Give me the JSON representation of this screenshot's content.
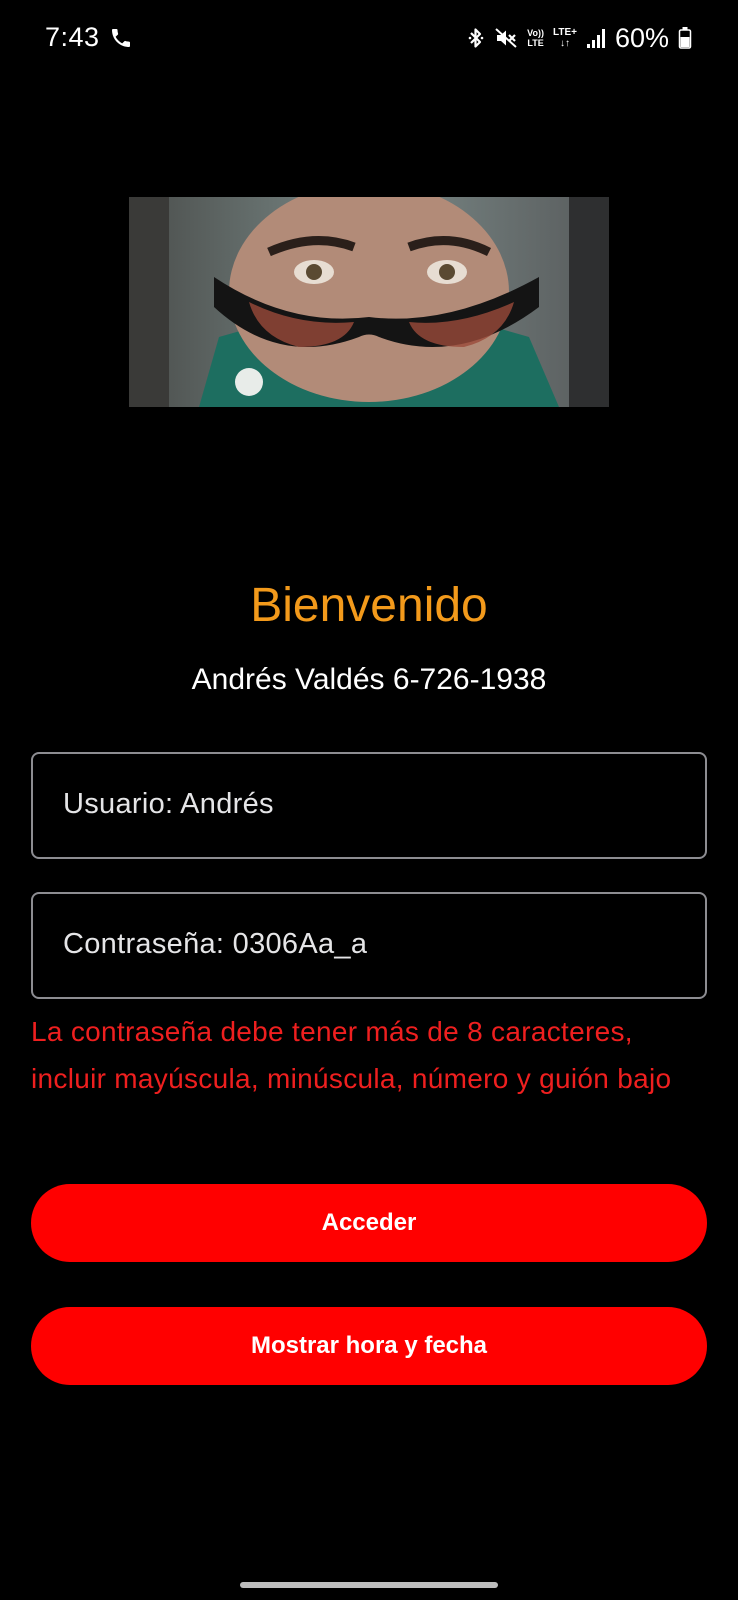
{
  "status_bar": {
    "time": "7:43",
    "icons": [
      "call-icon",
      "bluetooth-icon",
      "mute-icon",
      "volte-icon",
      "lte-plus-icon",
      "signal-icon",
      "battery-icon"
    ],
    "volte_top": "Vo))",
    "volte_bottom": "LTE",
    "lte_top": "LTE+",
    "lte_bottom": "↓↑",
    "battery": "60%"
  },
  "profile_image": {
    "description": "profile-photo"
  },
  "welcome": {
    "title": "Bienvenido",
    "user_info": "Andrés Valdés 6-726-1938"
  },
  "form": {
    "username_text": "Usuario: Andrés",
    "password_text": "Contraseña: 0306Aa_a",
    "error_message": "La contraseña debe tener más de 8 caracteres, incluir mayúscula, minúscula, número y guión bajo"
  },
  "buttons": {
    "access_label": "Acceder",
    "show_time_label": "Mostrar hora y fecha"
  },
  "colors": {
    "background": "#000000",
    "title_orange": "#f39a1b",
    "error_red": "#ef1f1f",
    "button_red": "#ff0000",
    "field_border": "#8d8d92"
  }
}
